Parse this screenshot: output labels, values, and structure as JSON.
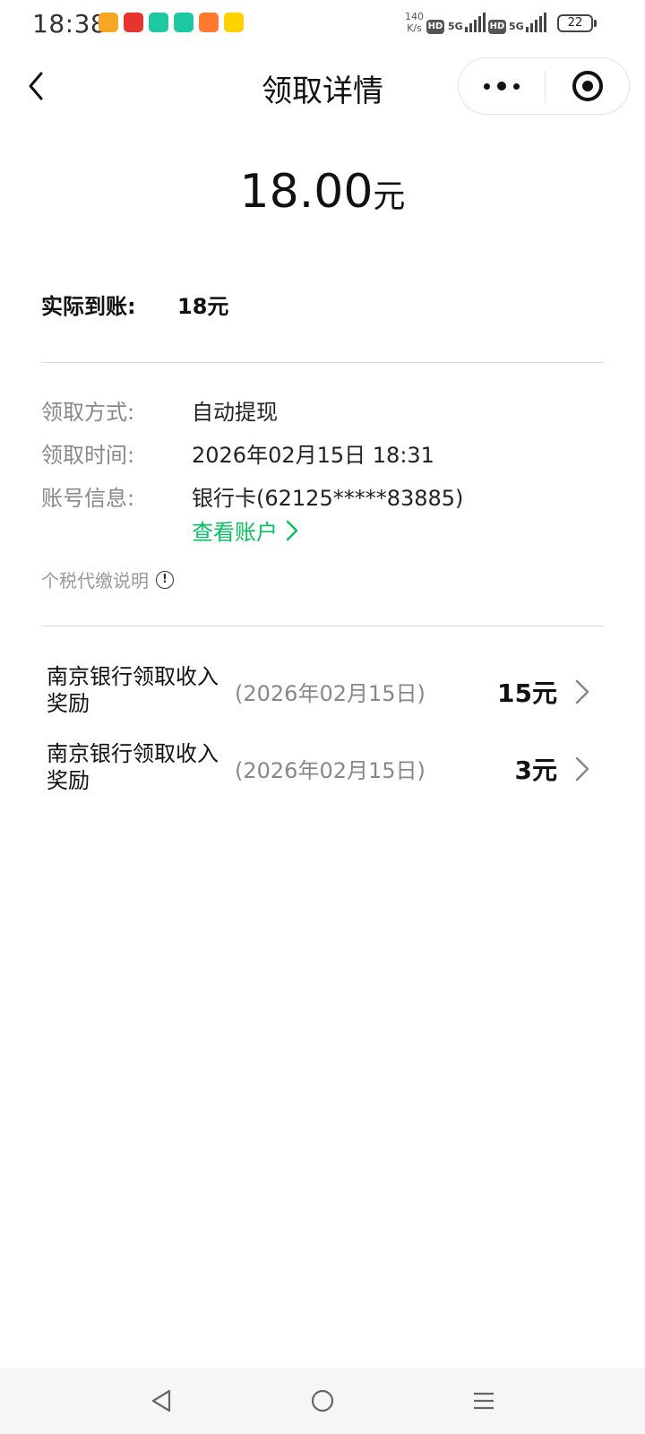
{
  "status_bar": {
    "time": "18:38",
    "net_speed_value": "140",
    "net_speed_unit": "K/s",
    "hd_label": "HD",
    "net_type": "5G",
    "battery": "22"
  },
  "nav": {
    "title": "领取详情"
  },
  "amount": {
    "value": "18.00",
    "unit": "元"
  },
  "actual": {
    "label": "实际到账:",
    "value": "18元"
  },
  "details": {
    "method_label": "领取方式:",
    "method_value": "自动提现",
    "time_label": "领取时间:",
    "time_value": "2026年02月15日 18:31",
    "account_label": "账号信息:",
    "account_value": "银行卡(62125*****83885)",
    "view_account": "查看账户"
  },
  "tax_note": "个税代缴说明",
  "items": [
    {
      "title": "南京银行领取收入奖励",
      "date": "(2026年02月15日)",
      "amount": "15元"
    },
    {
      "title": "南京银行领取收入奖励",
      "date": "(2026年02月15日)",
      "amount": "3元"
    }
  ],
  "colors": {
    "accent_green": "#07c160",
    "secondary_text": "#888888"
  }
}
